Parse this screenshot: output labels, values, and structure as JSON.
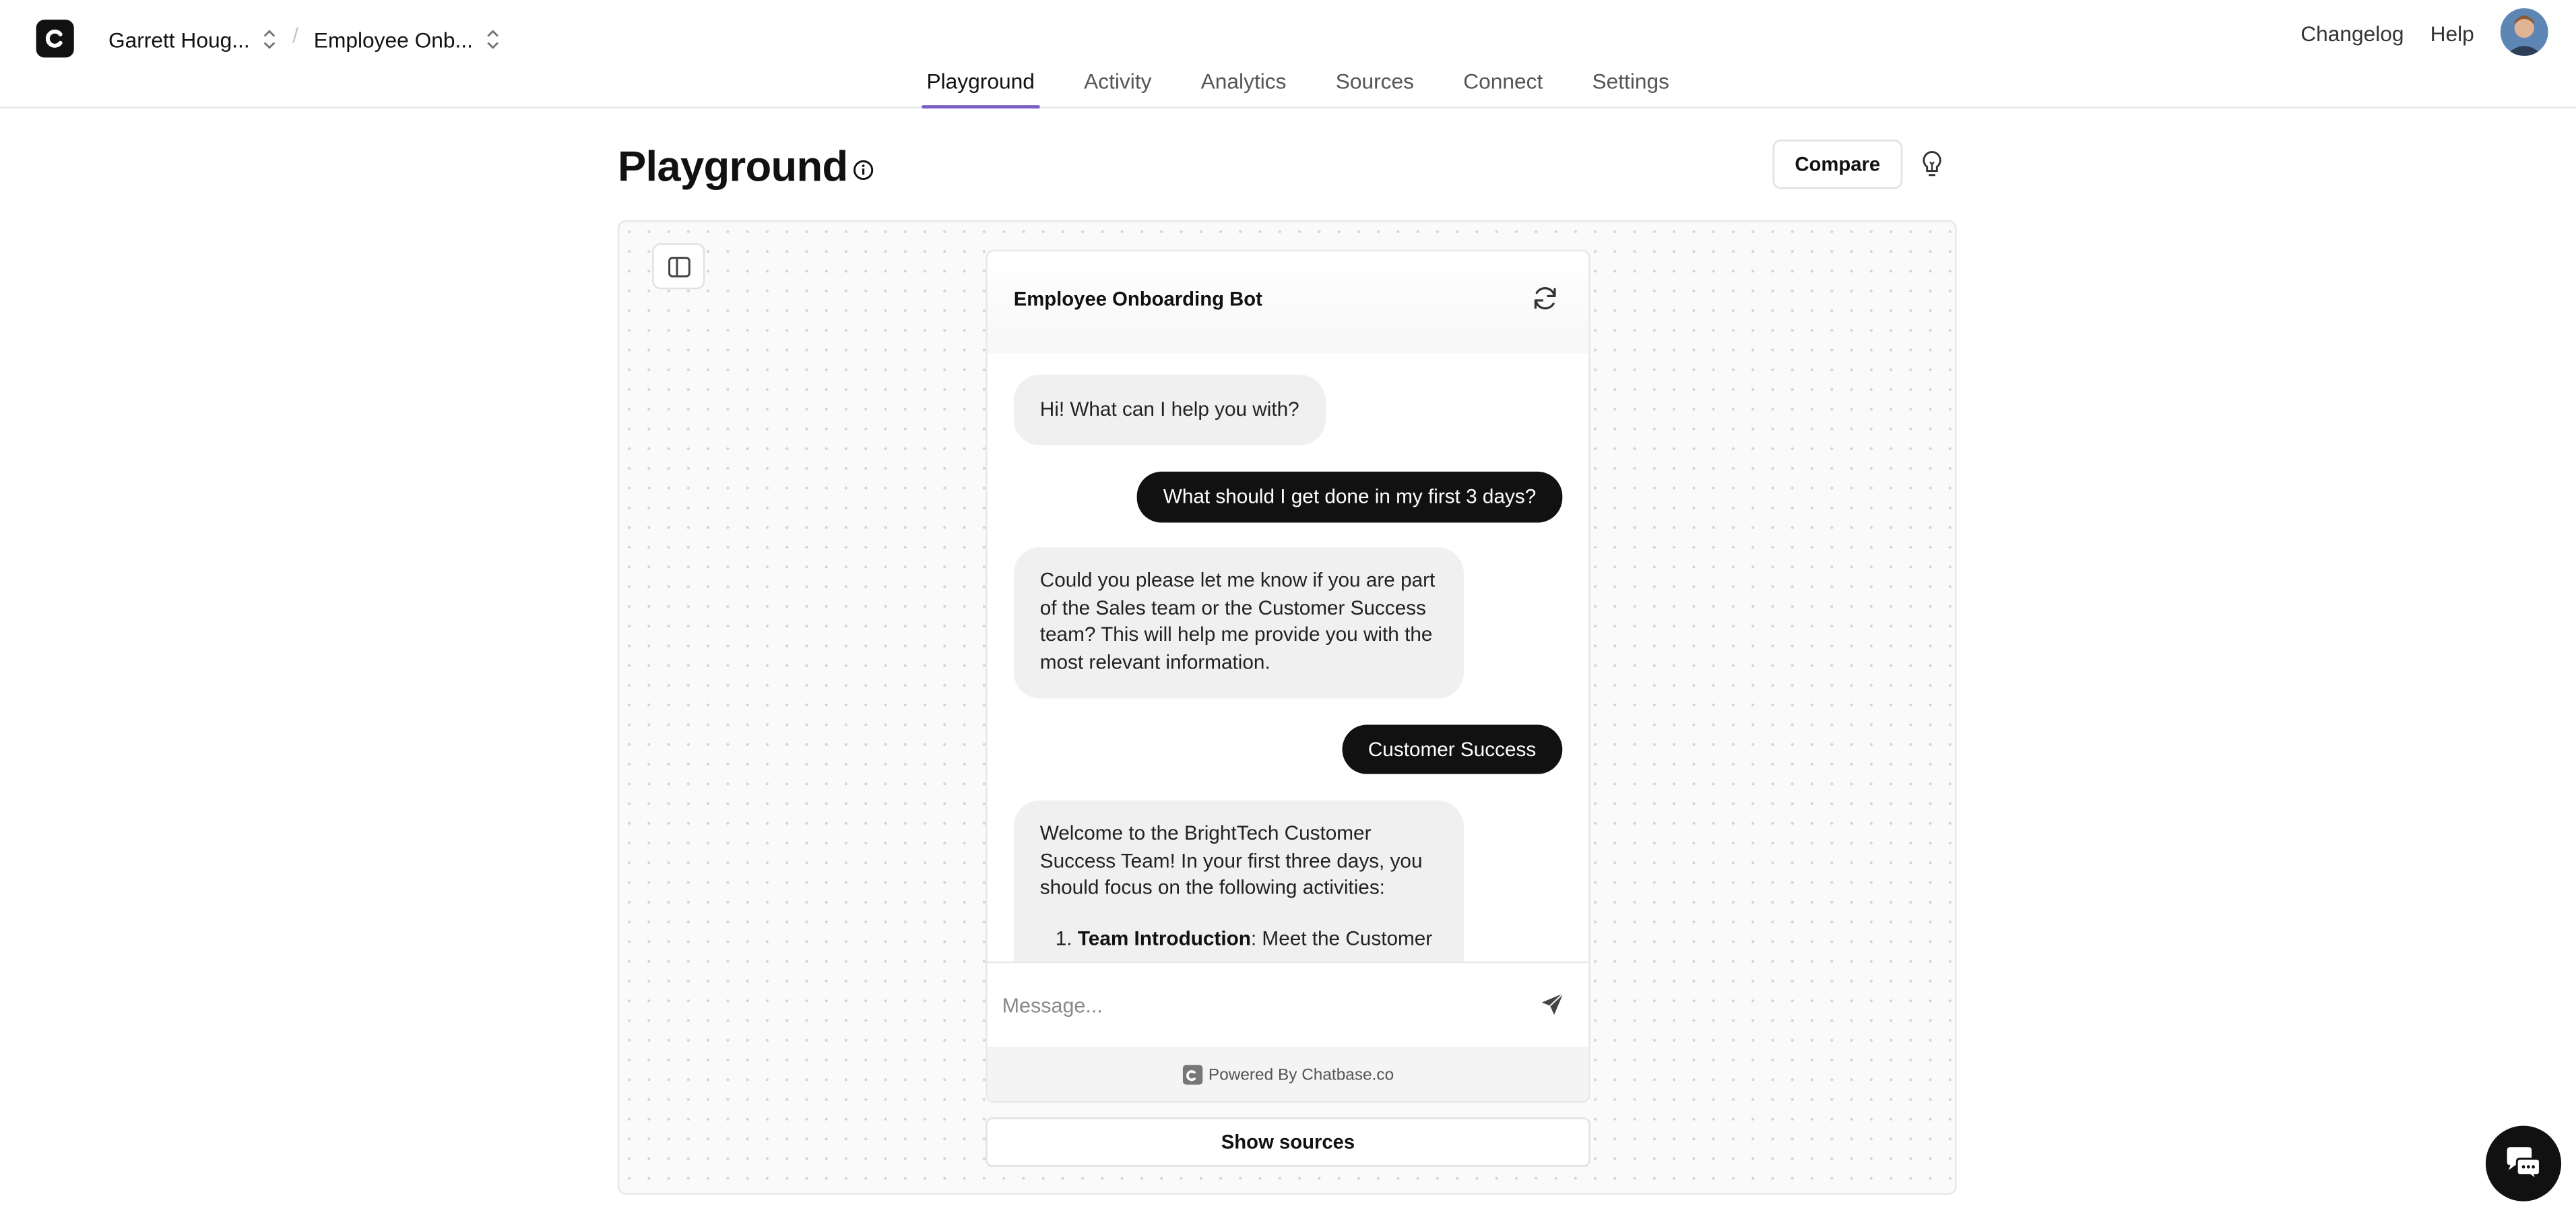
{
  "header": {
    "workspace": "Garrett Houg...",
    "separator": "/",
    "project": "Employee Onb...",
    "changelog": "Changelog",
    "help": "Help"
  },
  "nav": {
    "tabs": [
      {
        "label": "Playground",
        "active": true
      },
      {
        "label": "Activity"
      },
      {
        "label": "Analytics"
      },
      {
        "label": "Sources"
      },
      {
        "label": "Connect"
      },
      {
        "label": "Settings"
      }
    ]
  },
  "page": {
    "title": "Playground",
    "compare_label": "Compare"
  },
  "chat": {
    "bot_name": "Employee Onboarding Bot",
    "messages": [
      {
        "role": "bot",
        "text": "Hi! What can I help you with?"
      },
      {
        "role": "user",
        "text": "What should I get done in my first 3 days?"
      },
      {
        "role": "bot",
        "text": "Could you please let me know if you are part of the Sales team or the Customer Success team? This will help me provide you with the most relevant information."
      },
      {
        "role": "user",
        "text": "Customer Success"
      },
      {
        "role": "bot",
        "text": "Welcome to the BrightTech Customer Success Team! In your first three days, you should focus on the following activities:",
        "list_item_title": "Team Introduction",
        "list_item_text": ": Meet the Customer"
      }
    ],
    "input_placeholder": "Message...",
    "powered_by": "Powered By Chatbase.co",
    "show_sources": "Show sources"
  },
  "colors": {
    "accent": "#7c5fc5",
    "user_bubble": "#111111",
    "bot_bubble": "#f0f0f0"
  }
}
